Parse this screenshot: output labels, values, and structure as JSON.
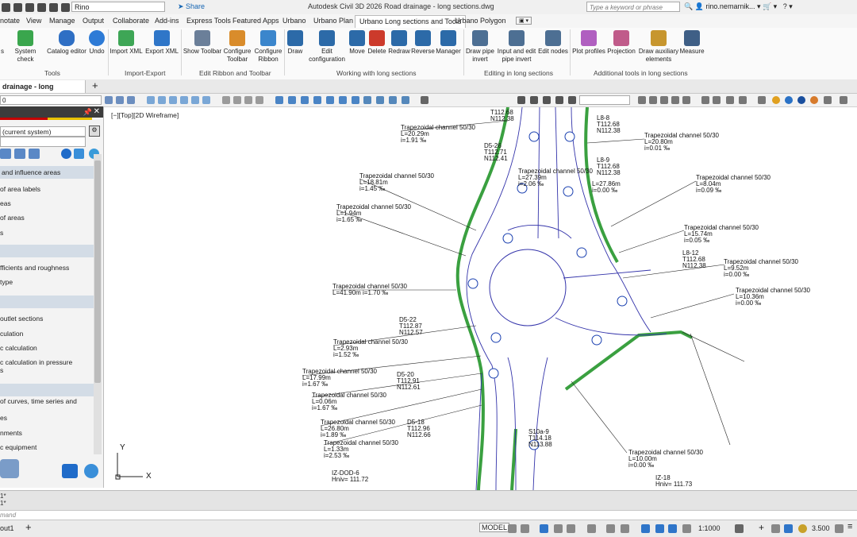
{
  "titlebar": {
    "workspace": "Rino",
    "share": "Share",
    "doc_title": "Autodesk Civil 3D 2026   Road drainage - long sections.dwg",
    "search_placeholder": "Type a keyword or phrase",
    "user": "rino.nemarnik..."
  },
  "ribbon_tabs": [
    "notate",
    "View",
    "Manage",
    "Output",
    "Collaborate",
    "Add-ins",
    "Express Tools",
    "Featured Apps",
    "Urbano",
    "Urbano Plan",
    "Urbano Long sections and Tools",
    "Urbano Polygon"
  ],
  "ribbon_active_tab": "Urbano Long sections and Tools",
  "ribbon": {
    "buttons": [
      {
        "label": "s"
      },
      {
        "label": "System check"
      },
      {
        "label": "Catalog editor"
      },
      {
        "label": "Undo"
      },
      {
        "label": "Import XML"
      },
      {
        "label": "Export XML"
      },
      {
        "label": "Show Toolbar"
      },
      {
        "label": "Configure Toolbar"
      },
      {
        "label": "Configure Ribbon"
      },
      {
        "label": "Draw"
      },
      {
        "label": "Edit configuration"
      },
      {
        "label": "Move"
      },
      {
        "label": "Delete"
      },
      {
        "label": "Redraw"
      },
      {
        "label": "Reverse"
      },
      {
        "label": "Manager"
      },
      {
        "label": "Draw pipe invert"
      },
      {
        "label": "Input and edit pipe invert"
      },
      {
        "label": "Edit nodes"
      },
      {
        "label": "Plot profiles"
      },
      {
        "label": "Projection"
      },
      {
        "label": "Draw auxiliary elements"
      },
      {
        "label": "Measure"
      }
    ],
    "panels": [
      "Tools",
      "Import-Export",
      "Edit Ribbon and Toolbar",
      "Working with long sections",
      "Editing in long sections",
      "Additional tools in long sections"
    ]
  },
  "doc_tab": "drainage - long sections*",
  "viewport_label": "[−][Top][2D Wireframe]",
  "palette": {
    "combo_value": "(current system)",
    "header1": "and influence areas",
    "items1": [
      "of area labels",
      "eas",
      "of areas",
      "s"
    ],
    "items2": [
      "fficients and roughness",
      "type"
    ],
    "items3": [
      "outlet sections",
      "culation",
      "c calculation",
      "c calculation in pressure",
      "s"
    ],
    "items4": [
      "of curves, time series and",
      "es",
      "nments",
      "c equipment"
    ]
  },
  "drawing_labels": {
    "top": [
      "T112.68",
      "N112.38",
      "T112.68",
      "N112.38"
    ],
    "channels": [
      {
        "title": "Trapezoidal channel 50/30",
        "l": "L=20.29m",
        "i": "i=1.91 ‰"
      },
      {
        "title": "Trapezoidal channel 50/30",
        "l": "L=20.80m",
        "i": "i=0.01 ‰"
      },
      {
        "title": "Trapezoidal channel 50/30",
        "l": "L=18.81m",
        "i": "i=1.45 ‰"
      },
      {
        "title": "Trapezoidal channel 50/30",
        "l": "L=27.39m",
        "i": "i=2.06 ‰"
      },
      {
        "title": "Trapezoidal channel 50/30",
        "l": "L=27.86m",
        "i": "i=0.00 ‰"
      },
      {
        "title": "Trapezoidal channel 50/30",
        "l": "L=8.04m",
        "i": "i=0.09 ‰"
      },
      {
        "title": "Trapezoidal channel 50/30",
        "l": "L=1.94m",
        "i": "i=1.65 ‰"
      },
      {
        "title": "Trapezoidal channel 50/30",
        "l": "L=15.74m",
        "i": "i=0.05 ‰"
      },
      {
        "title": "Trapezoidal channel 50/30",
        "l": "L=9.52m",
        "i": "i=0.00 ‰"
      },
      {
        "title": "Trapezoidal channel 50/30",
        "l": "L=41.90m  i=1.70 ‰",
        "i": ""
      },
      {
        "title": "Trapezoidal channel 50/30",
        "l": "L=10.36m",
        "i": "i=0.00 ‰"
      },
      {
        "title": "Trapezoidal channel 50/30",
        "l": "L=2.93m",
        "i": "i=1.52 ‰"
      },
      {
        "title": "Trapezoidal channel 50/30",
        "l": "L=17.99m",
        "i": "i=1.67 ‰"
      },
      {
        "title": "Trapezoidal channel 50/30",
        "l": "L=0.06m",
        "i": "i=1.67 ‰"
      },
      {
        "title": "Trapezoidal channel 50/30",
        "l": "L=26.80m",
        "i": "i=1.89 ‰"
      },
      {
        "title": "Trapezoidal channel 50/30",
        "l": "L=1.33m",
        "i": "i=2.53 ‰"
      },
      {
        "title": "Trapezoidal channel 50/30",
        "l": "L=10.00m",
        "i": "i=0.00 ‰"
      }
    ],
    "nodes": [
      {
        "name": "L8-8",
        "t": "T112.68",
        "n": "N112.38"
      },
      {
        "name": "D5-26",
        "t": "T112.71",
        "n": "N112.41"
      },
      {
        "name": "L8-9",
        "t": "T112.68",
        "n": "N112.38"
      },
      {
        "name": "L8-12",
        "t": "T112.68",
        "n": "N112.38"
      },
      {
        "name": "D5-22",
        "t": "T112.87",
        "n": "N112.57"
      },
      {
        "name": "D5-20",
        "t": "T112.91",
        "n": "N112.61"
      },
      {
        "name": "D5-18",
        "t": "T112.96",
        "n": "N112.66"
      },
      {
        "name": "S10a-9",
        "t": "T114.18",
        "n": "N113.88"
      }
    ],
    "extra": [
      "IZ-DOD-6",
      "Hniv= 111.72",
      "IZ-18",
      "Hniv= 111.73"
    ]
  },
  "command": {
    "lines": [
      "1*",
      "1*"
    ],
    "input_placeholder": "mand"
  },
  "statusbar": {
    "layout_tab": "out1",
    "model": "MODEL",
    "scale": "1:1000",
    "zoom": "3.500"
  }
}
